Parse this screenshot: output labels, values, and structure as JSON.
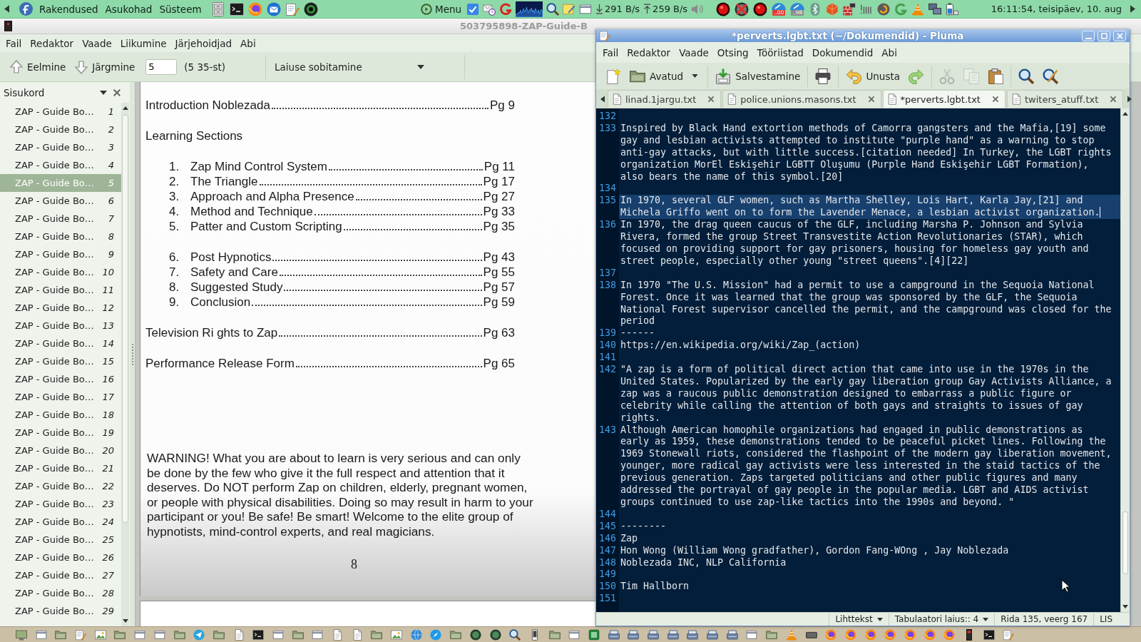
{
  "top_panel": {
    "menus": [
      "Rakendused",
      "Asukohad",
      "Süsteem"
    ],
    "menu_button": "Menu",
    "download_rate": "291 B/s",
    "upload_rate": "259 B/s",
    "badges": [
      {
        "label": "..00",
        "color": "#e53935"
      },
      {
        "label": "..98",
        "color": "#8c8c8c"
      }
    ],
    "clock": "16:11:54, teisipäev, 10. aug"
  },
  "document_viewer": {
    "window": {
      "title": "503795898-ZAP-Guide-B"
    },
    "menu_bar": [
      "Fail",
      "Redaktor",
      "Vaade",
      "Liikumine",
      "Järjehoidjad",
      "Abi"
    ],
    "toolbar": {
      "previous": "Eelmine",
      "next": "Järgmine",
      "page_field": {
        "value": "5"
      },
      "page_count": "(5 35-st)",
      "zoom": "Laiuse sobitamine"
    },
    "sidebar": {
      "title": "Sisukord",
      "items": [
        {
          "label": "ZAP - Guide Bo…",
          "page": "1",
          "selected": false
        },
        {
          "label": "ZAP - Guide Bo…",
          "page": "2",
          "selected": false
        },
        {
          "label": "ZAP - Guide Bo…",
          "page": "3",
          "selected": false
        },
        {
          "label": "ZAP - Guide Bo…",
          "page": "4",
          "selected": false
        },
        {
          "label": "ZAP - Guide Bo…",
          "page": "5",
          "selected": true
        },
        {
          "label": "ZAP - Guide Bo…",
          "page": "6",
          "selected": false
        },
        {
          "label": "ZAP - Guide Bo…",
          "page": "7",
          "selected": false
        },
        {
          "label": "ZAP - Guide Bo…",
          "page": "8",
          "selected": false
        },
        {
          "label": "ZAP - Guide Bo…",
          "page": "9",
          "selected": false
        },
        {
          "label": "ZAP - Guide Bo…",
          "page": "10",
          "selected": false
        },
        {
          "label": "ZAP - Guide Bo…",
          "page": "11",
          "selected": false
        },
        {
          "label": "ZAP - Guide Bo…",
          "page": "12",
          "selected": false
        },
        {
          "label": "ZAP - Guide Bo…",
          "page": "13",
          "selected": false
        },
        {
          "label": "ZAP - Guide Bo…",
          "page": "14",
          "selected": false
        },
        {
          "label": "ZAP - Guide Bo…",
          "page": "15",
          "selected": false
        },
        {
          "label": "ZAP - Guide Bo…",
          "page": "16",
          "selected": false
        },
        {
          "label": "ZAP - Guide Bo…",
          "page": "17",
          "selected": false
        },
        {
          "label": "ZAP - Guide Bo…",
          "page": "18",
          "selected": false
        },
        {
          "label": "ZAP - Guide Bo…",
          "page": "19",
          "selected": false
        },
        {
          "label": "ZAP - Guide Bo…",
          "page": "20",
          "selected": false
        },
        {
          "label": "ZAP - Guide Bo…",
          "page": "21",
          "selected": false
        },
        {
          "label": "ZAP - Guide Bo…",
          "page": "22",
          "selected": false
        },
        {
          "label": "ZAP - Guide Bo…",
          "page": "23",
          "selected": false
        },
        {
          "label": "ZAP - Guide Bo…",
          "page": "24",
          "selected": false
        },
        {
          "label": "ZAP - Guide Bo…",
          "page": "25",
          "selected": false
        },
        {
          "label": "ZAP - Guide Bo…",
          "page": "26",
          "selected": false
        },
        {
          "label": "ZAP - Guide Bo…",
          "page": "27",
          "selected": false
        },
        {
          "label": "ZAP - Guide Bo…",
          "page": "28",
          "selected": false
        },
        {
          "label": "ZAP - Guide Bo…",
          "page": "29",
          "selected": false
        }
      ]
    },
    "page": {
      "contents": [
        {
          "kind": "entry",
          "title": "Introduction Noblezada",
          "page": "Pg 9"
        },
        {
          "kind": "heading",
          "title": "Learning Sections"
        },
        {
          "kind": "list",
          "items": [
            {
              "number": "1.",
              "title": "Zap Mind Control System",
              "page": "Pg 11"
            },
            {
              "number": "2.",
              "title": "The Triangle",
              "page": "Pg 17"
            },
            {
              "number": "3.",
              "title": "Approach and Alpha Presence",
              "page": "Pg 27"
            },
            {
              "number": "4.",
              "title": "Method and Technique",
              "page": "Pg 33"
            },
            {
              "number": "5.",
              "title": "Patter and Custom Scripting",
              "page": "Pg 35"
            }
          ]
        },
        {
          "kind": "list",
          "items": [
            {
              "number": "6.",
              "title": "Post Hypnotics",
              "page": "Pg 43"
            },
            {
              "number": "7.",
              "title": "Safety and Care",
              "page": "Pg 55"
            },
            {
              "number": "8.",
              "title": "Suggested Study",
              "page": "Pg 57"
            },
            {
              "number": "9.",
              "title": "Conclusion",
              "page": "Pg 59"
            }
          ]
        },
        {
          "kind": "entry",
          "title": "Television Ri ghts to Zap",
          "page": "Pg 63"
        },
        {
          "kind": "entry",
          "title": "Performance Release Form",
          "page": "Pg 65"
        },
        {
          "kind": "paragraph",
          "text": "WARNING! What you are about to learn is very serious and can only be done by the few who give it the full respect and attention that it deserves. Do NOT perform Zap on children, elderly, pregnant women, or people with physical disabilities. Doing so may result in harm to your participant or you! Be safe! Be smart! Welcome to the elite group of hypnotists, mind-control experts, and real magicians."
        },
        {
          "kind": "page_number",
          "text": "8"
        }
      ]
    }
  },
  "text_editor": {
    "window": {
      "title": "*perverts.lgbt.txt (~/Dokumendid) - Pluma"
    },
    "menu_bar": [
      "Fail",
      "Redaktor",
      "Vaade",
      "Otsing",
      "Tööriistad",
      "Dokumendid",
      "Abi"
    ],
    "toolbar_groups": [
      {
        "buttons": [
          {
            "kind": "new",
            "disabled": false
          },
          {
            "kind": "open",
            "label": "Avatud",
            "disabled": false
          }
        ]
      },
      {
        "buttons": [
          {
            "kind": "save",
            "label": "Salvestamine",
            "disabled": false
          }
        ]
      },
      {
        "buttons": [
          {
            "kind": "print",
            "disabled": false
          }
        ]
      },
      {
        "buttons": [
          {
            "kind": "undo",
            "label": "Unusta",
            "disabled": false
          },
          {
            "kind": "redo",
            "disabled": false
          }
        ]
      },
      {
        "buttons": [
          {
            "kind": "cut",
            "disabled": true
          },
          {
            "kind": "copy",
            "disabled": true
          },
          {
            "kind": "paste",
            "disabled": false
          }
        ]
      },
      {
        "buttons": [
          {
            "kind": "find",
            "disabled": false
          },
          {
            "kind": "replace",
            "disabled": false
          }
        ]
      }
    ],
    "tabs": [
      {
        "label": "linad.1jargu.txt",
        "selected": false
      },
      {
        "label": "police.unions.masons.txt",
        "selected": false
      },
      {
        "label": "*perverts.lgbt.txt",
        "selected": true
      },
      {
        "label": "twiters_atuff.txt",
        "selected": false
      }
    ],
    "lines": [
      {
        "number": "132",
        "current": false
      },
      {
        "number": "133",
        "text": "Inspired by Black Hand extortion methods of Camorra gangsters and the Mafia,[19] some gay and lesbian activists attempted to institute \"purple hand\" as a warning to stop anti-gay attacks, but with little success.[citation needed] In Turkey, the LGBT rights organization MorEl Eskişehir LGBTT Oluşumu (Purple Hand Eskişehir LGBT Formation), also bears the name of this symbol.[20]",
        "current": false
      },
      {
        "number": "134",
        "current": false
      },
      {
        "number": "135",
        "text": "In 1970, several GLF women, such as Martha Shelley, Lois Hart, Karla Jay,[21] and Michela Griffo went on to form the Lavender Menace, a lesbian activist organization.",
        "current": true
      },
      {
        "number": "136",
        "text": "In 1970, the drag queen caucus of the GLF, including Marsha P. Johnson and Sylvia Rivera, formed the group Street Transvestite Action Revolutionaries (STAR), which focused on providing support for gay prisoners, housing for homeless gay youth and street people, especially other young \"street queens\".[4][22]",
        "current": false
      },
      {
        "number": "137",
        "current": false
      },
      {
        "number": "138",
        "text": "In 1970 \"The U.S. Mission\" had a permit to use a campground in the Sequoia National Forest. Once it was learned that the group was sponsored by the GLF, the Sequoia National Forest supervisor cancelled the permit, and the campground was closed for the period",
        "current": false
      },
      {
        "number": "139",
        "text": "------",
        "current": false
      },
      {
        "number": "140",
        "text": "https://en.wikipedia.org/wiki/Zap_(action)",
        "current": false
      },
      {
        "number": "141",
        "current": false
      },
      {
        "number": "142",
        "text": "\"A zap is a form of political direct action that came into use in the 1970s in the United States. Popularized by the early gay liberation group Gay Activists Alliance, a zap was a raucous public demonstration designed to embarrass a public figure or celebrity while calling the attention of both gays and straights to issues of gay rights.",
        "current": false
      },
      {
        "number": "143",
        "text": "Although American homophile organizations had engaged in public demonstrations as early as 1959, these demonstrations tended to be peaceful picket lines. Following the 1969 Stonewall riots, considered the flashpoint of the modern gay liberation movement, younger, more radical gay activists were less interested in the staid tactics of the previous generation. Zaps targeted politicians and other public figures and many addressed the portrayal of gay people in the popular media. LGBT and AIDS activist groups continued to use zap-like tactics into the 1990s and beyond. \"",
        "current": false
      },
      {
        "number": "144",
        "current": false
      },
      {
        "number": "145",
        "text": "--------",
        "current": false
      },
      {
        "number": "146",
        "text": "Zap",
        "current": false
      },
      {
        "number": "147",
        "text": "Hon Wong (William Wong gradfather), Gordon Fang-WOng , Jay Noblezada",
        "current": false
      },
      {
        "number": "148",
        "text": "Noblezada INC, NLP California",
        "current": false
      },
      {
        "number": "149",
        "current": false
      },
      {
        "number": "150",
        "text": "Tim Hallborn",
        "current": false
      },
      {
        "number": "151",
        "current": false
      }
    ],
    "status_bar": {
      "language": "Lihttekst",
      "tab_width": "Tabulaatori laius:: 4",
      "position": "Rida 135, veerg 167",
      "mode": "LIS"
    }
  }
}
